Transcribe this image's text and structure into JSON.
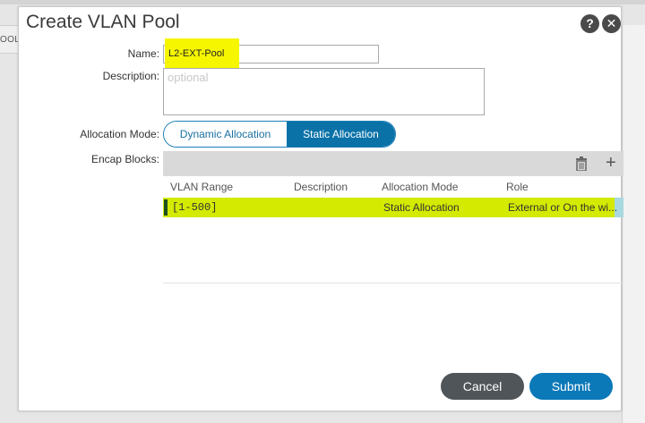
{
  "background": {
    "strip_text": "OOL"
  },
  "dialog": {
    "title": "Create VLAN Pool",
    "help_icon": "?",
    "close_icon": "✕"
  },
  "form": {
    "name_label": "Name:",
    "name_value": "L2-EXT-Pool",
    "description_label": "Description:",
    "description_placeholder": "optional",
    "allocation_mode_label": "Allocation Mode:",
    "allocation_options": [
      "Dynamic Allocation",
      "Static Allocation"
    ],
    "allocation_selected": "Static Allocation",
    "encap_blocks_label": "Encap Blocks:"
  },
  "table": {
    "columns": [
      "VLAN Range",
      "Description",
      "Allocation Mode",
      "Role"
    ],
    "rows": [
      {
        "vlan_range": "[1-500]",
        "description": "",
        "allocation_mode": "Static Allocation",
        "role": "External or On the wi..."
      }
    ]
  },
  "buttons": {
    "cancel": "Cancel",
    "submit": "Submit"
  },
  "colors": {
    "highlight": "#f6f600",
    "row_highlight": "#d4ea00",
    "accent": "#0b72a8",
    "cancel": "#505559"
  }
}
